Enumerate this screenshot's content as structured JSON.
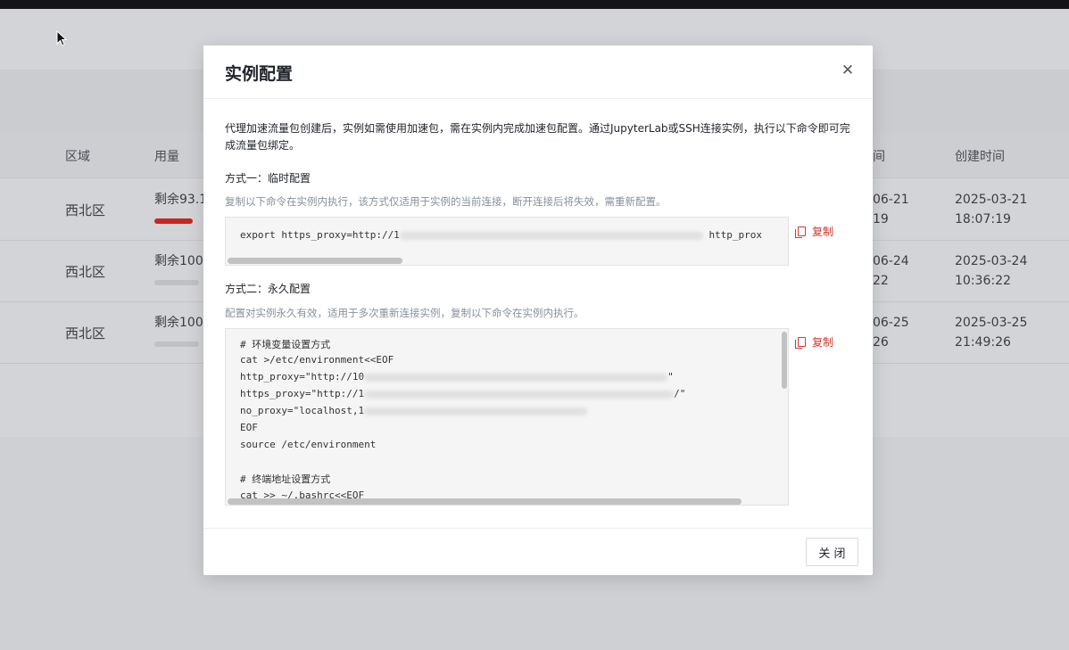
{
  "background": {
    "table": {
      "headers": [
        "区域",
        "用量",
        "间",
        "创建时间"
      ],
      "rows": [
        {
          "region": "西北区",
          "usage": "剩余93.1",
          "bar_fill": 0.85,
          "bar_color": "#c8281f",
          "exp_date": "06-21",
          "exp_time": "19",
          "created_date": "2025-03-21",
          "created_time": "18:07:19"
        },
        {
          "region": "西北区",
          "usage": "剩余100",
          "bar_fill": 0,
          "bar_color": "#c0c1c4",
          "exp_date": "06-24",
          "exp_time": "22",
          "created_date": "2025-03-24",
          "created_time": "10:36:22"
        },
        {
          "region": "西北区",
          "usage": "剩余100",
          "bar_fill": 0,
          "bar_color": "#c0c1c4",
          "exp_date": "06-25",
          "exp_time": "26",
          "created_date": "2025-03-25",
          "created_time": "21:49:26"
        }
      ]
    }
  },
  "modal": {
    "title": "实例配置",
    "close_icon": "close-icon",
    "intro": "代理加速流量包创建后，实例如需使用加速包，需在实例内完成加速包配置。通过JupyterLab或SSH连接实例，执行以下命令即可完成流量包绑定。",
    "method1": {
      "title": "方式一：临时配置",
      "desc": "复制以下命令在实例内执行，该方式仅适用于实例的当前连接，断开连接后将失效，需重新配置。",
      "code_prefix": "export https_proxy=http://1",
      "code_suffix": "http_prox",
      "copy_label": "复制"
    },
    "method2": {
      "title": "方式二：永久配置",
      "desc": "配置对实例永久有效，适用于多次重新连接实例，复制以下命令在实例内执行。",
      "lines": [
        "# 环境变量设置方式",
        "cat >/etc/environment<<EOF",
        "http_proxy=\"http://10",
        "https_proxy=\"http://1",
        "no_proxy=\"localhost,1",
        "EOF",
        "source /etc/environment",
        "",
        "# 终端地址设置方式",
        "cat >> ~/.bashrc<<EOF"
      ],
      "line_ends": [
        "\"",
        "/\""
      ],
      "copy_label": "复制"
    },
    "footer": {
      "close_label": "关 闭"
    }
  }
}
